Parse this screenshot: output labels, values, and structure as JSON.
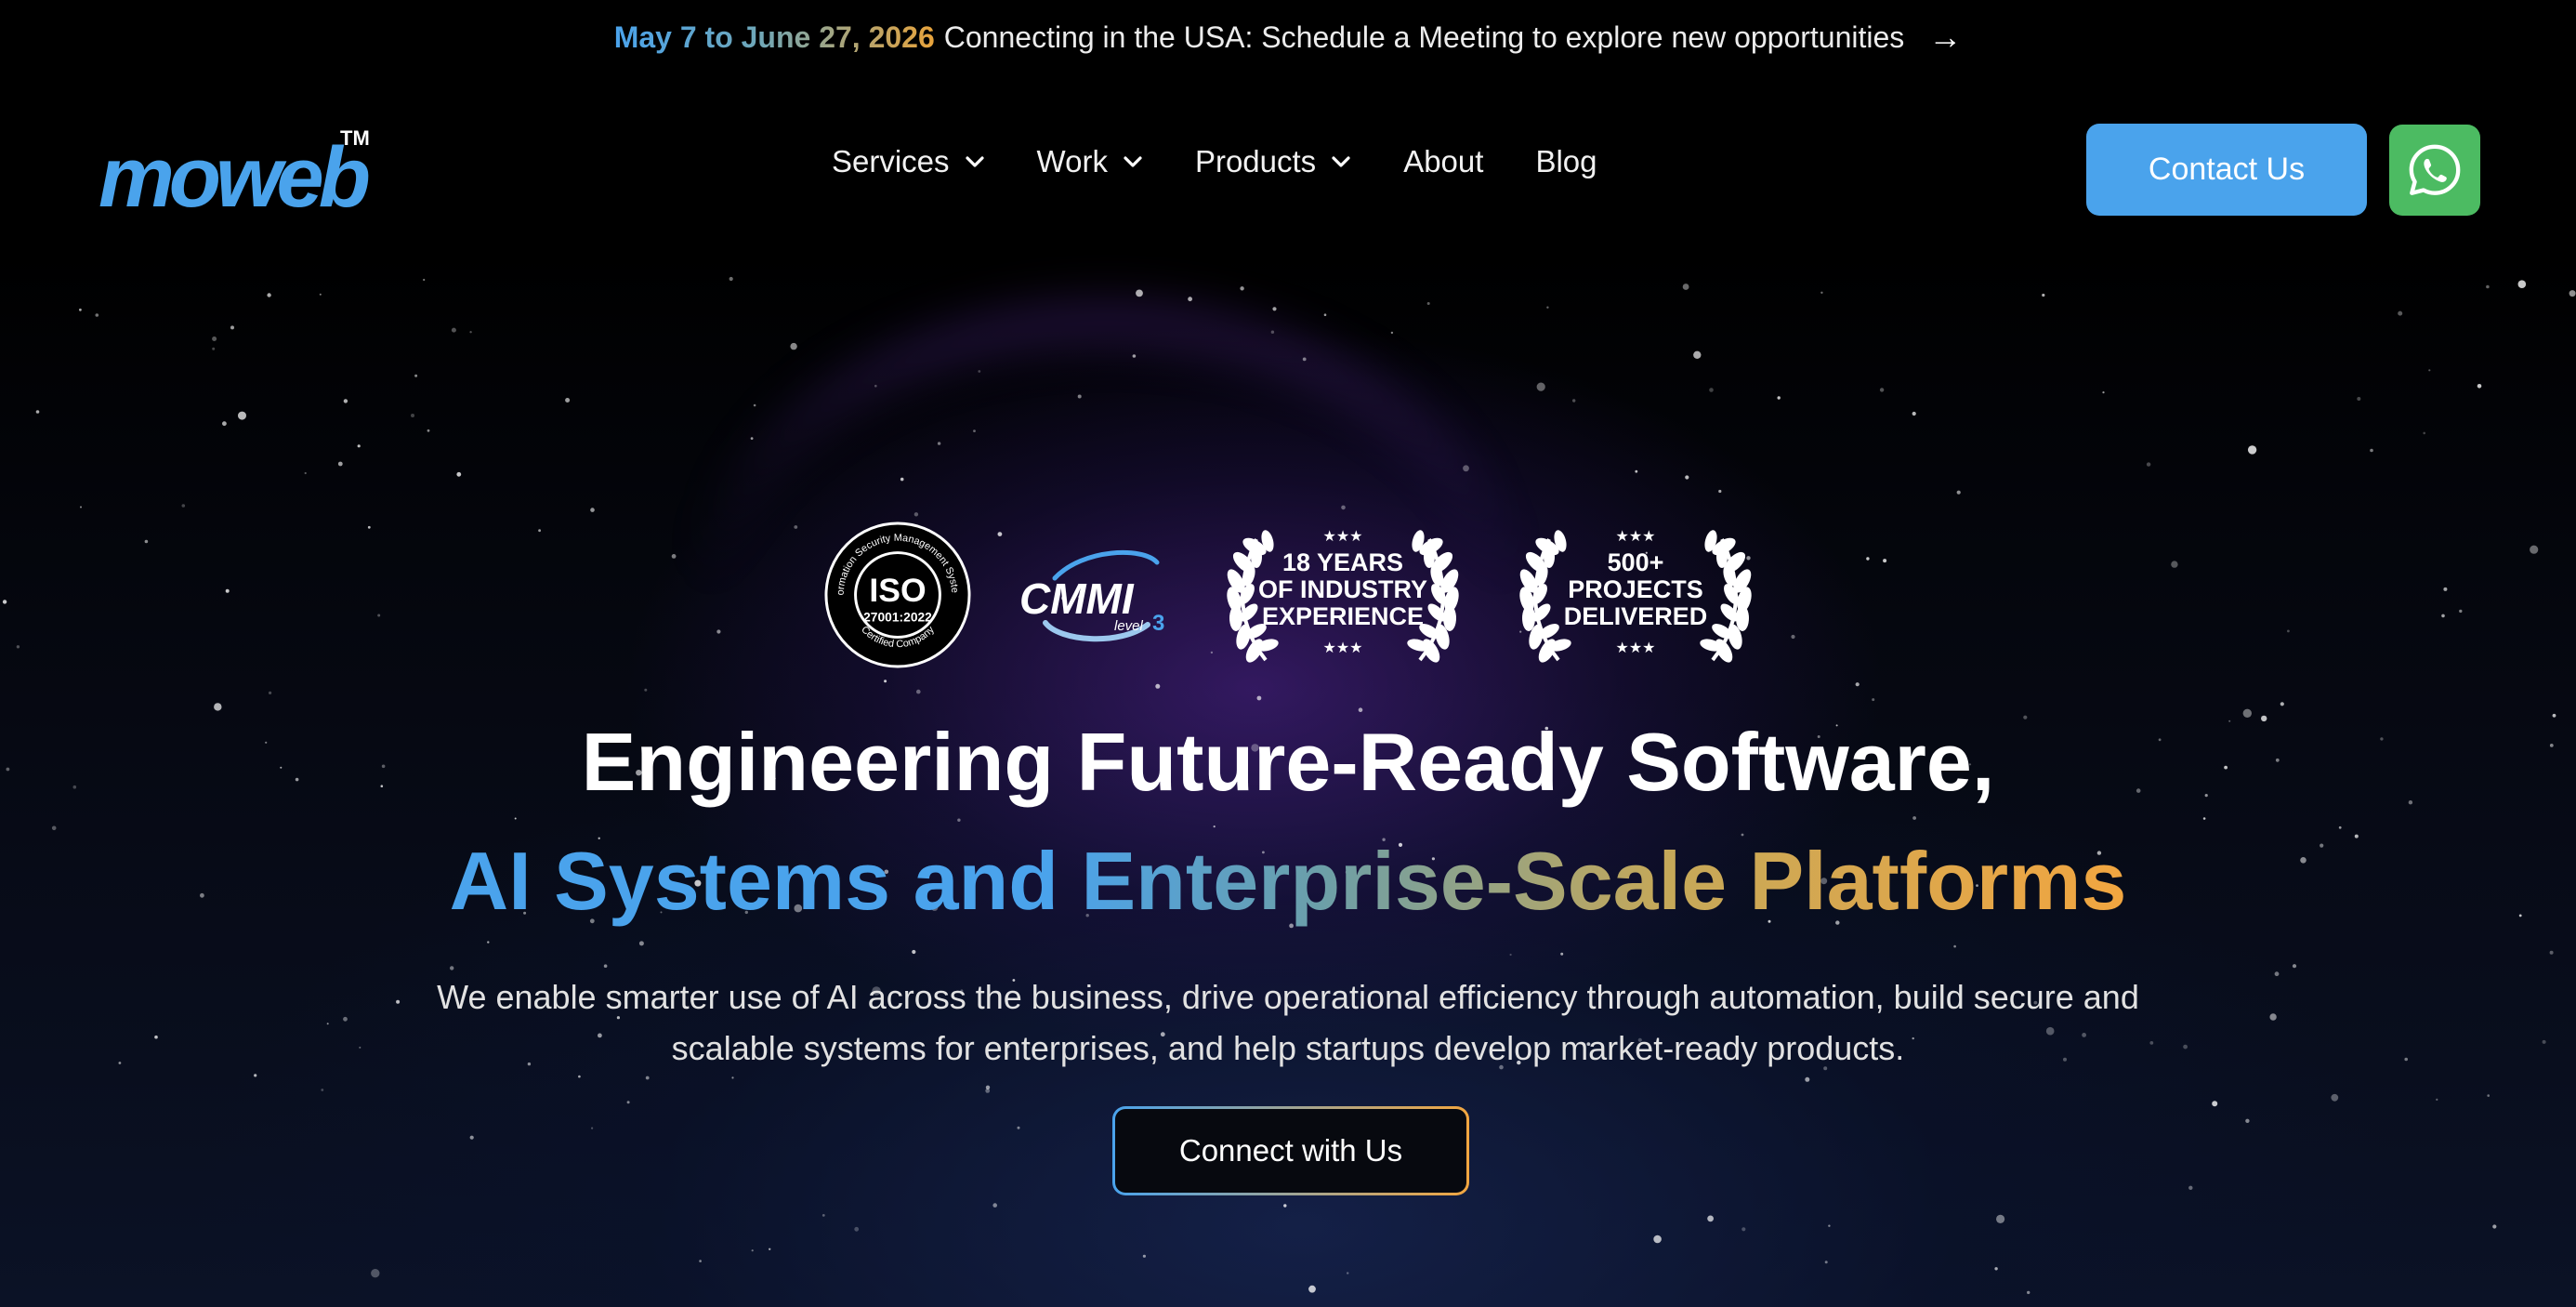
{
  "announcement": {
    "date_text": "May 7 to June 27, 2026",
    "message": "Connecting in the USA: Schedule a Meeting to explore new opportunities",
    "arrow": "→"
  },
  "header": {
    "logo_text": "moweb",
    "logo_mark": "TM",
    "nav": [
      {
        "label": "Services",
        "has_dropdown": true
      },
      {
        "label": "Work",
        "has_dropdown": true
      },
      {
        "label": "Products",
        "has_dropdown": true
      },
      {
        "label": "About",
        "has_dropdown": false
      },
      {
        "label": "Blog",
        "has_dropdown": false
      }
    ],
    "contact_label": "Contact Us",
    "whatsapp_icon": "whatsapp-icon"
  },
  "badges": {
    "iso": {
      "main": "ISO",
      "code": "27001:2022",
      "ring_top": "Information Security Management Systems",
      "ring_bottom": "Certified Company"
    },
    "cmmi": {
      "main": "CMMI",
      "level_word": "level",
      "level_num": "3"
    },
    "years": {
      "line1": "18 YEARS",
      "line2": "OF INDUSTRY",
      "line3": "EXPERIENCE",
      "stars": "★★★"
    },
    "projects": {
      "line1": "500+",
      "line2": "PROJECTS",
      "line3": "DELIVERED",
      "stars": "★★★"
    }
  },
  "hero": {
    "title_line1": "Engineering Future-Ready Software,",
    "title_line2": "AI Systems and Enterprise-Scale Platforms",
    "subtitle_line1": "We enable smarter use of AI across the business, drive operational efficiency through automation, build secure and",
    "subtitle_line2": "scalable systems for enterprises, and help startups develop market-ready products.",
    "cta_label": "Connect with Us"
  },
  "colors": {
    "accent_blue": "#4aa3ec",
    "accent_orange": "#f2a640",
    "whatsapp_green": "#4cbb62",
    "background": "#000000"
  }
}
